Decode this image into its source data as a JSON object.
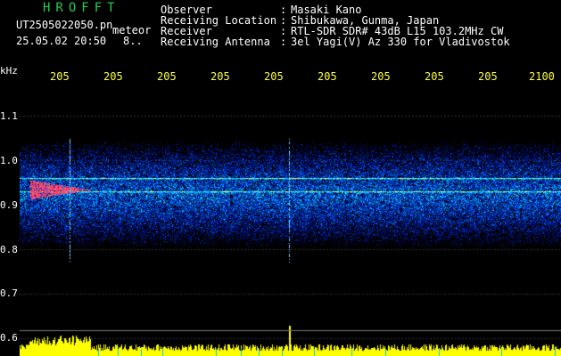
{
  "title": "HROFFT",
  "file_info": {
    "filename": "UT2505022050.pn",
    "type": "meteor",
    "datetime": "25.05.02 20:50",
    "count": "8.."
  },
  "header": {
    "rows": [
      {
        "label": "Observer",
        "value": "Masaki Kano"
      },
      {
        "label": "Receiving Location",
        "value": "Shibukawa, Gunma, Japan"
      },
      {
        "label": "Receiver",
        "value": "RTL-SDR SDR# 43dB L15 103.2MHz CW"
      },
      {
        "label": "Receiving Antenna",
        "value": "3el Yagi(V) Az 330 for Vladivostok"
      }
    ],
    "separator": ":"
  },
  "axis": {
    "unit": "kHz",
    "y_ticks": [
      "1.1",
      "1.0",
      "0.9",
      "0.8",
      "0.7",
      "0.6"
    ],
    "time_ticks": [
      "205",
      "205",
      "205",
      "205",
      "205",
      "205",
      "205",
      "205",
      "205",
      "2100"
    ]
  },
  "colors": {
    "title": "#22d04a",
    "text": "#ffffff",
    "time_axis": "#ffff40",
    "background": "#000000",
    "echo": "#ff2060",
    "level_trace": "#ffff00",
    "ping_ticks": "#00c8ff"
  }
}
